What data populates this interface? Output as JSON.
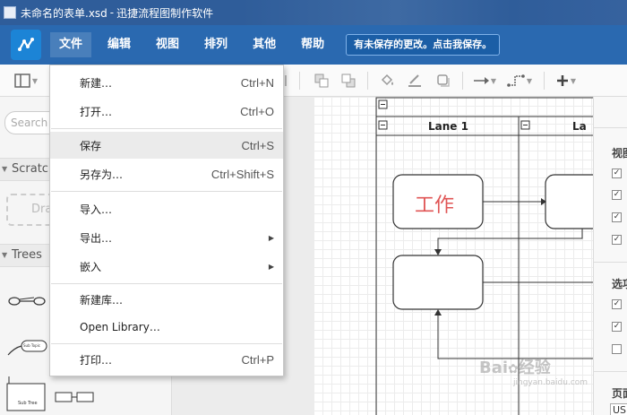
{
  "window": {
    "document_name": "未命名的表单.xsd",
    "separator": "-",
    "app_name": "迅捷流程图制作软件"
  },
  "menubar": {
    "items": [
      "文件",
      "编辑",
      "视图",
      "排列",
      "其他",
      "帮助"
    ],
    "save_notice": "有未保存的更改。点击我保存。"
  },
  "sidebar": {
    "search_placeholder": "Search",
    "scratchpad_title": "Scratch",
    "scratchpad_drop": "Dra",
    "trees_title": "Trees",
    "tree_shape_labels": [
      "Sub Topic",
      "Sub Tree"
    ]
  },
  "file_menu": {
    "items": [
      {
        "label": "新建…",
        "shortcut": "Ctrl+N"
      },
      {
        "label": "打开…",
        "shortcut": "Ctrl+O"
      },
      {
        "label": "保存",
        "shortcut": "Ctrl+S"
      },
      {
        "label": "另存为…",
        "shortcut": "Ctrl+Shift+S"
      },
      {
        "label": "导入…",
        "shortcut": ""
      },
      {
        "label": "导出…",
        "shortcut": ""
      },
      {
        "label": "嵌入",
        "shortcut": ""
      },
      {
        "label": "新建库…",
        "shortcut": ""
      },
      {
        "label": "Open Library…",
        "shortcut": ""
      },
      {
        "label": "打印…",
        "shortcut": "Ctrl+P"
      }
    ]
  },
  "diagram": {
    "lane1_title": "Lane 1",
    "lane2_title": "La",
    "collapse_symbol": "⊟",
    "task_text": "工作",
    "task_text_color": "#e05555"
  },
  "right_panel": {
    "section1_title": "视图",
    "section2_title": "选项",
    "section3_title": "页面",
    "select_value": "US"
  },
  "watermark": {
    "brand": "Bai",
    "brand_suffix": "经验",
    "sub": "jingyan.baidu.com"
  },
  "colors": {
    "title_bar": "#2f5d9a",
    "menu_bar": "#2a69b0",
    "logo": "#1c84d6"
  }
}
